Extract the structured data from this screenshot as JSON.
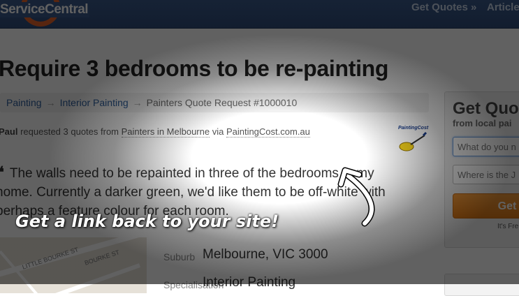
{
  "header": {
    "logo": "ServiceCentral",
    "nav": [
      "Get Quotes »",
      "Article"
    ]
  },
  "page": {
    "title": "Require 3 bedrooms to be re-painting",
    "breadcrumb": [
      "Painting",
      "Interior Painting",
      "Painters Quote Request #1000010"
    ],
    "request": {
      "name": "Paul",
      "text1": " requested 3 quotes from ",
      "link1": "Painters in Melbourne",
      "text2": " via ",
      "link2": "PaintingCost.com.au"
    },
    "source_logo_text": "PaintingCost",
    "quote_mark": "❝",
    "quote_text": "The walls need to be repainted in three of the bedrooms in my home. Currently a darker green, we'd like them to be off-white with perhaps a feature colour for each room.",
    "map_streets": [
      "LITTLE BOURKE ST",
      "BOURKE ST"
    ],
    "details": [
      {
        "label": "Suburb",
        "value": "Melbourne, VIC 3000"
      },
      {
        "label": "Specialisation",
        "value": "Interior Painting"
      }
    ]
  },
  "sidebar": {
    "heading": "Get Quot",
    "subheading": "from local pai",
    "input1_placeholder": "What do you n",
    "input2_placeholder": "Where is the J",
    "button": "Get",
    "free_note": "It's Fre"
  },
  "callout": "Get a link back to your site!",
  "colors": {
    "nav": "#3a5a8c",
    "accent": "#e8632a",
    "button": "#e17a15",
    "link": "#2c5c9a"
  }
}
